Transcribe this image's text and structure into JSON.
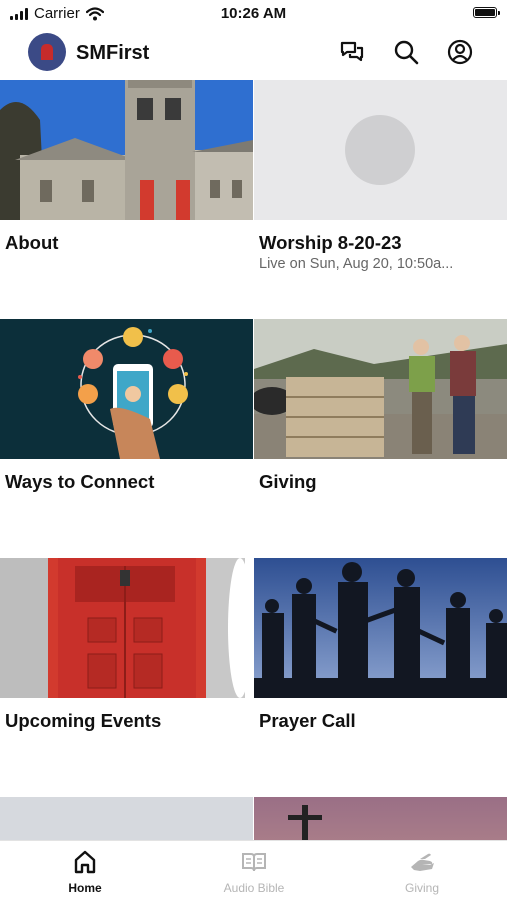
{
  "status_bar": {
    "carrier": "Carrier",
    "time": "10:26 AM"
  },
  "header": {
    "app_name": "SMFirst",
    "icons": [
      "chat-icon",
      "search-icon",
      "account-icon"
    ]
  },
  "tiles": [
    {
      "title": "About",
      "subtitle": ""
    },
    {
      "title": "Worship 8-20-23",
      "subtitle": "Live on Sun, Aug 20, 10:50a..."
    },
    {
      "title": "Ways to Connect",
      "subtitle": ""
    },
    {
      "title": "Giving",
      "subtitle": ""
    },
    {
      "title": "Upcoming Events",
      "subtitle": ""
    },
    {
      "title": "Prayer Call",
      "subtitle": ""
    }
  ],
  "tab_bar": [
    {
      "label": "Home",
      "icon": "home-icon",
      "active": true
    },
    {
      "label": "Audio Bible",
      "icon": "book-icon",
      "active": false
    },
    {
      "label": "Giving",
      "icon": "giving-hand-icon",
      "active": false
    }
  ],
  "colors": {
    "church_door_red": "#d23a2e",
    "placeholder_gray": "#e8e8ea",
    "connect_bg": "#0c2f3a"
  }
}
